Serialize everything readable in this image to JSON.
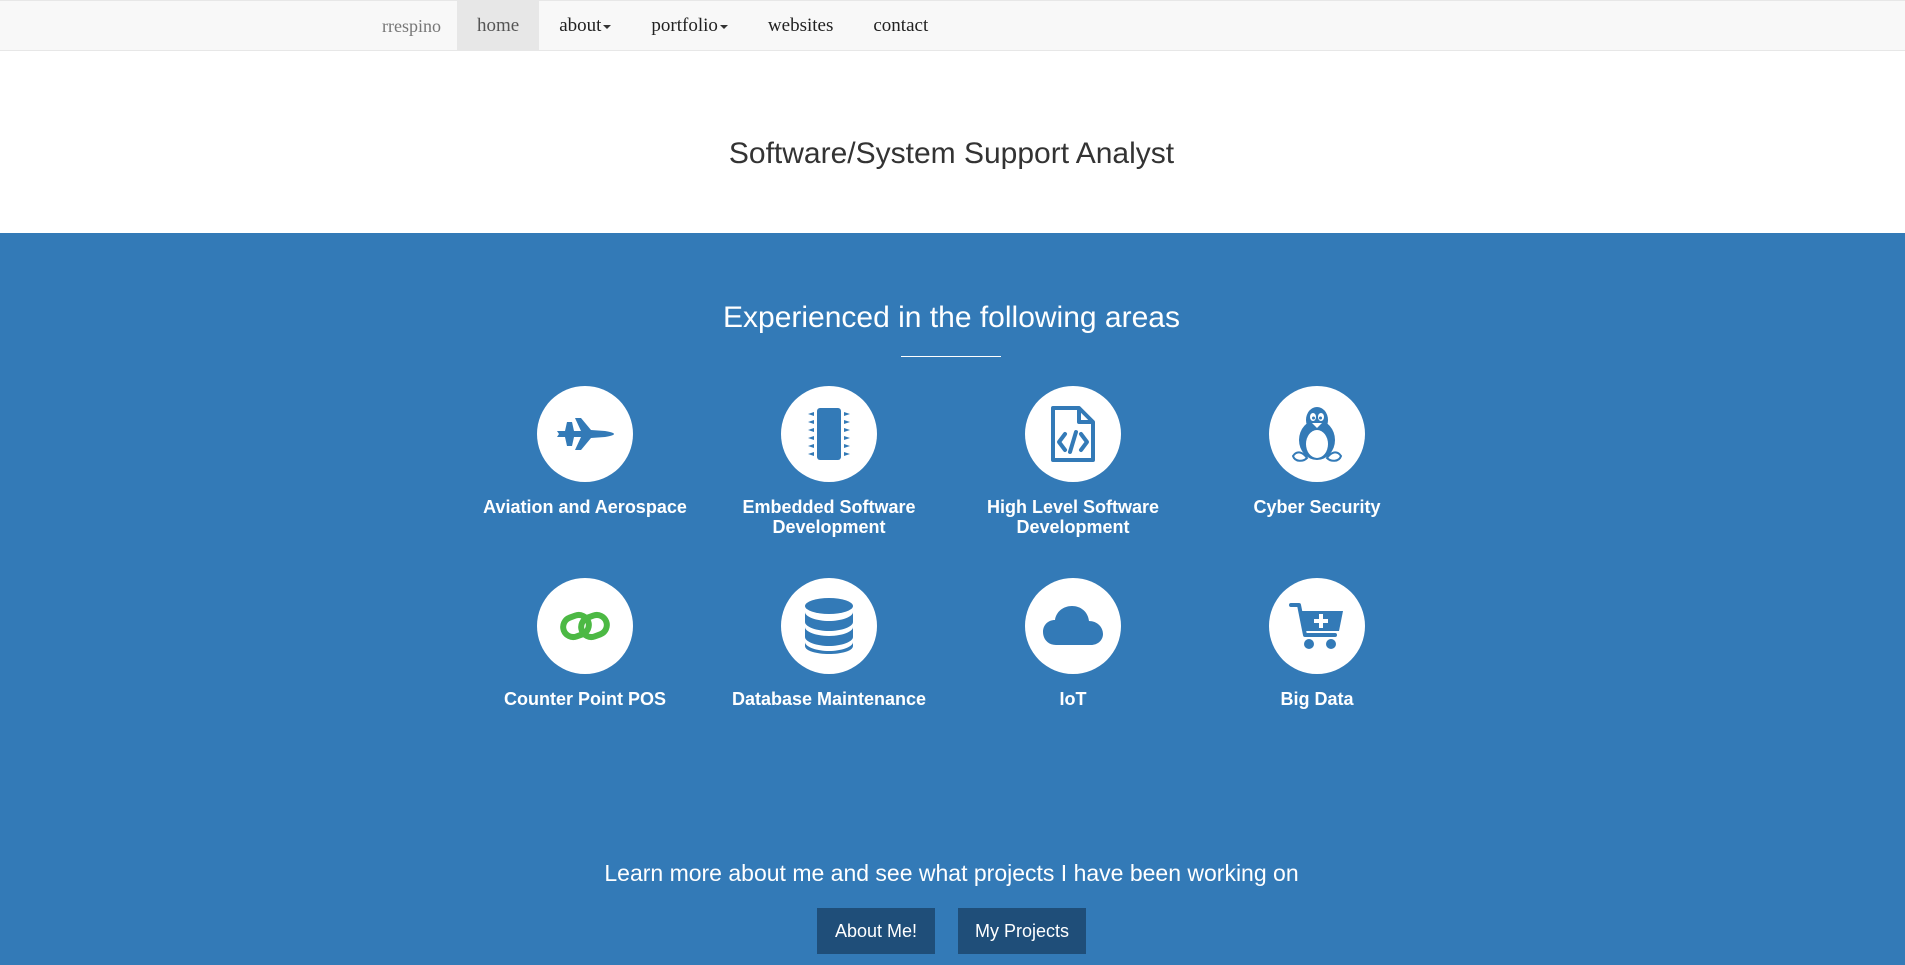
{
  "navbar": {
    "brand": "rrespino",
    "items": [
      {
        "label": "home",
        "active": true,
        "dropdown": false
      },
      {
        "label": "about",
        "active": false,
        "dropdown": true
      },
      {
        "label": "portfolio",
        "active": false,
        "dropdown": true
      },
      {
        "label": "websites",
        "active": false,
        "dropdown": false
      },
      {
        "label": "contact",
        "active": false,
        "dropdown": false
      }
    ]
  },
  "header": {
    "title": "Software/System Support Analyst"
  },
  "services": {
    "heading": "Experienced in the following areas",
    "items": [
      {
        "label": "Aviation and Aerospace",
        "icon": "fighter-jet-icon"
      },
      {
        "label": "Embedded Software Development",
        "icon": "microchip-icon"
      },
      {
        "label": "High Level Software Development",
        "icon": "code-file-icon"
      },
      {
        "label": "Cyber Security",
        "icon": "linux-tux-icon"
      },
      {
        "label": "Counter Point POS",
        "icon": "counterpoint-logo-icon"
      },
      {
        "label": "Database Maintenance",
        "icon": "database-icon"
      },
      {
        "label": "IoT",
        "icon": "cloud-icon"
      },
      {
        "label": "Big Data",
        "icon": "cart-plus-icon"
      }
    ]
  },
  "cta": {
    "text": "Learn more about me and see what projects I have been working on",
    "about_button": "About Me!",
    "projects_button": "My Projects"
  },
  "colors": {
    "primary": "#337ab7",
    "button_dark": "#1f4e79",
    "navbar_bg": "#f8f8f8",
    "counterpoint_green": "#4cb944"
  }
}
